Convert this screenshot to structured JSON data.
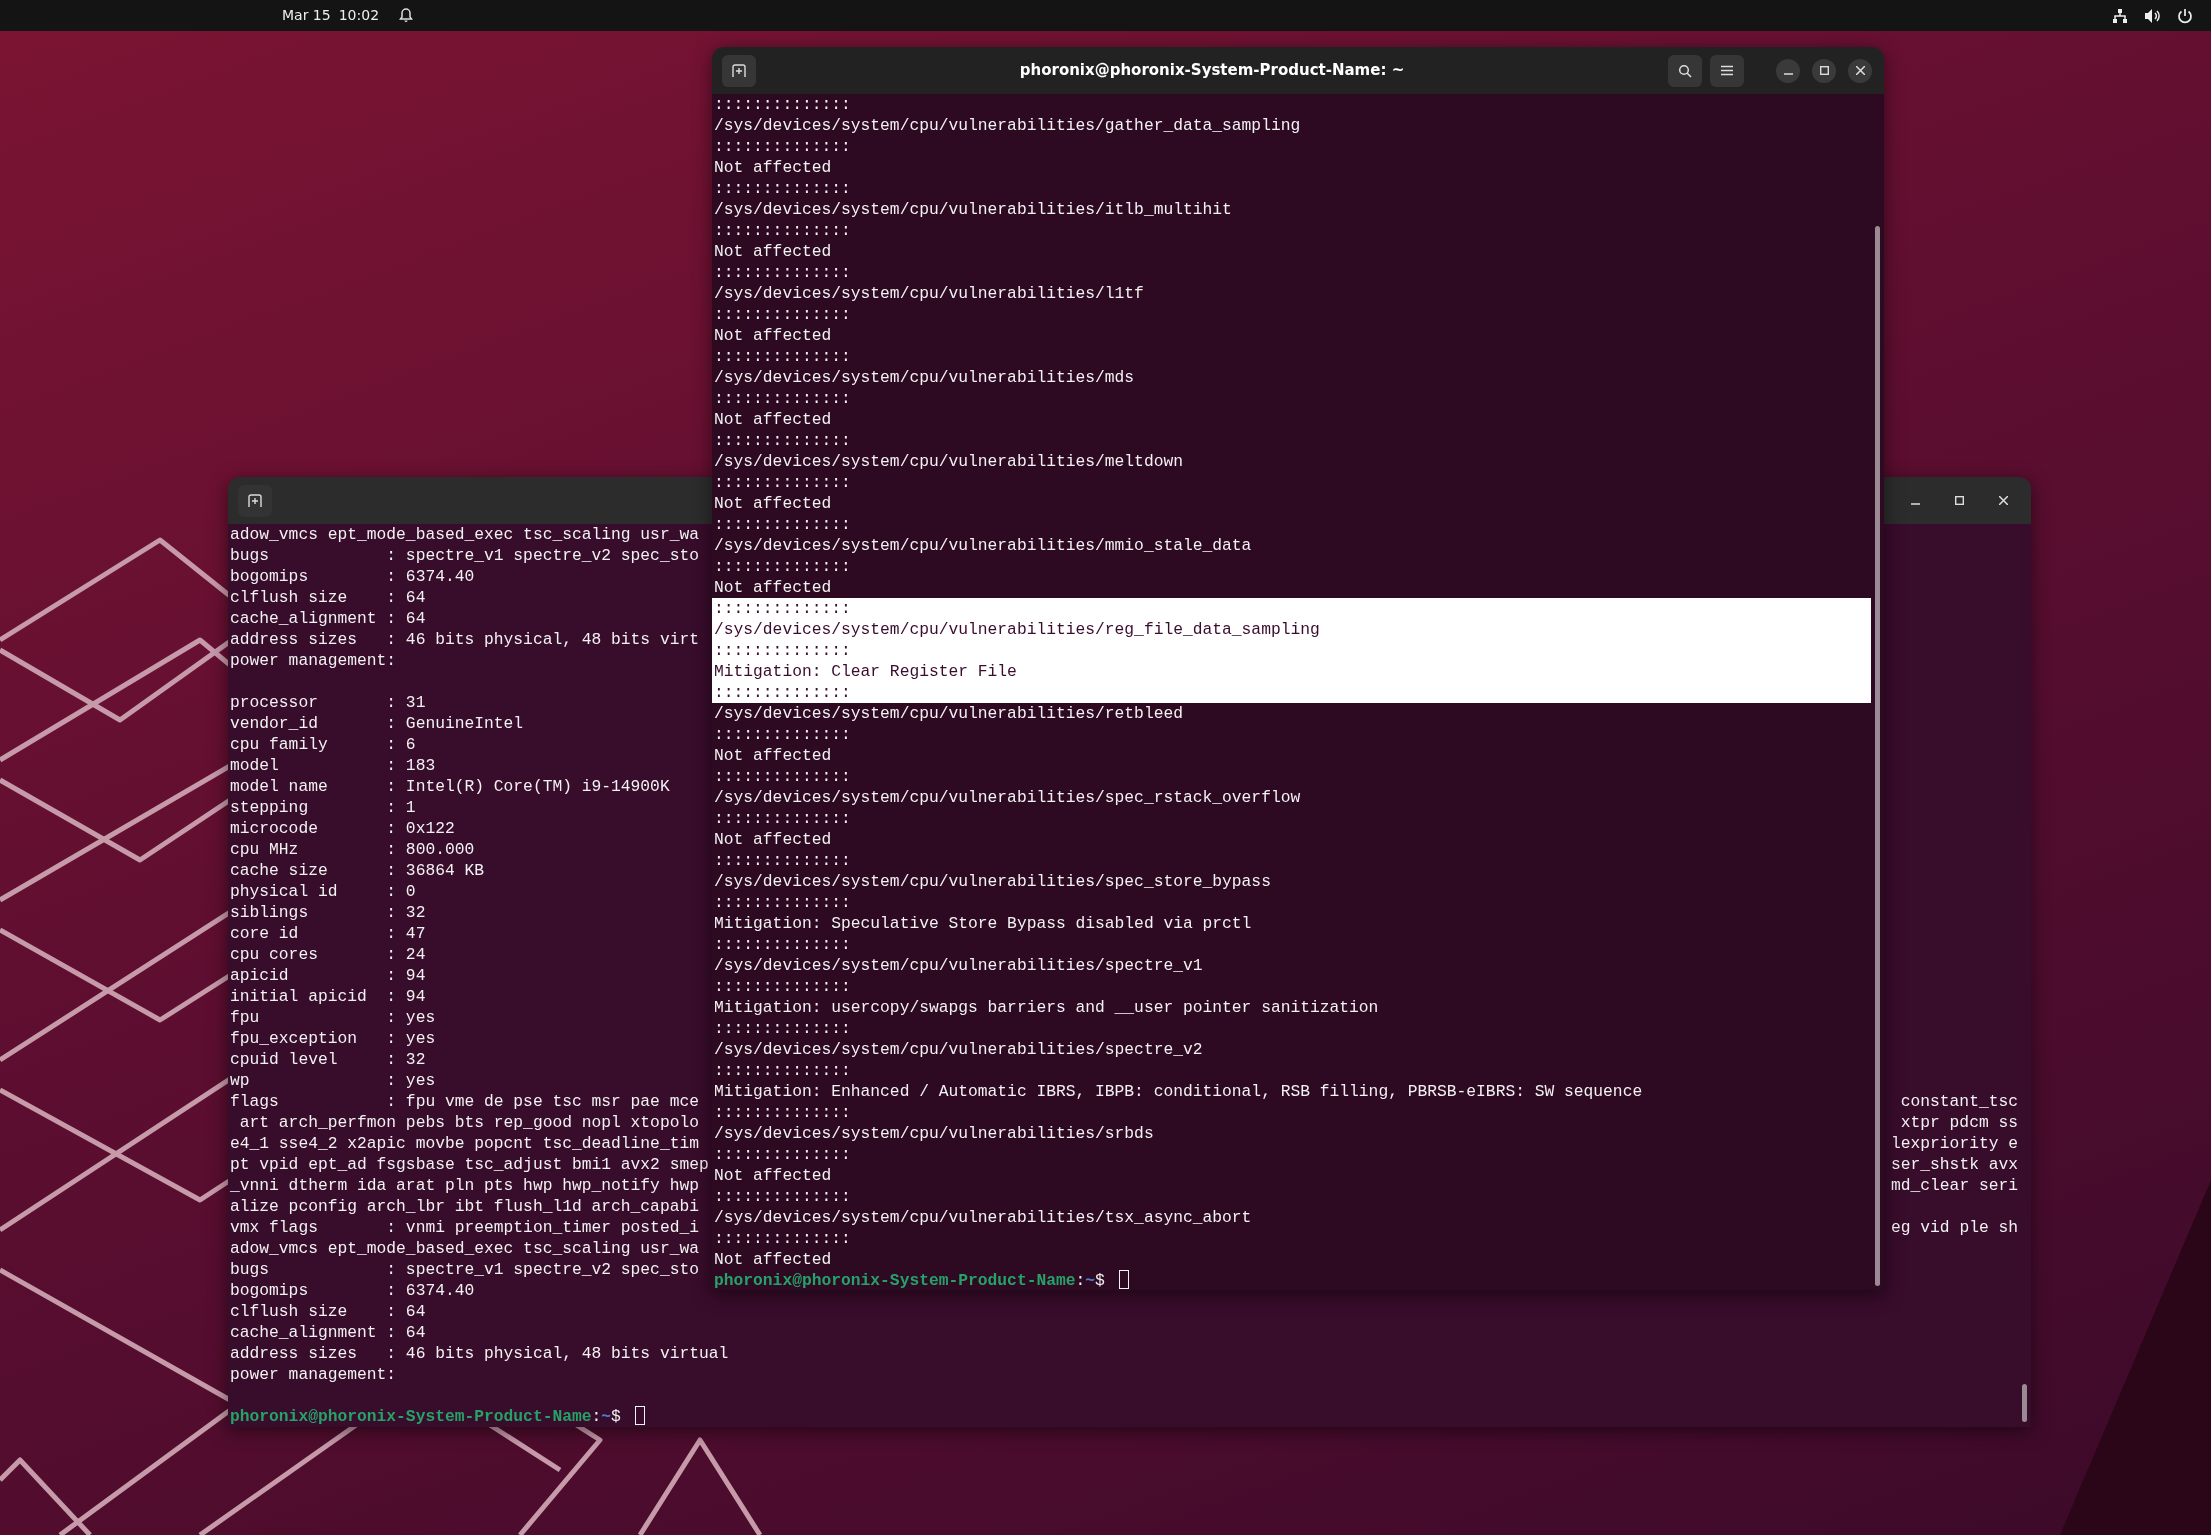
{
  "top_bar": {
    "date": "Mar 15",
    "time": "10:02"
  },
  "windows": [
    {
      "focused": false,
      "lines": [
        {
          "text": "adow_vmcs ept_mode_based_exec tsc_scaling usr_wa"
        },
        {
          "text": "bugs            : spectre_v1 spectre_v2 spec_sto"
        },
        {
          "text": "bogomips        : 6374.40"
        },
        {
          "text": "clflush size    : 64"
        },
        {
          "text": "cache_alignment : 64"
        },
        {
          "text": "address sizes   : 46 bits physical, 48 bits virt"
        },
        {
          "text": "power management:"
        },
        {
          "text": "processor       : 31",
          "gap_before": true
        },
        {
          "text": "vendor_id       : GenuineIntel"
        },
        {
          "text": "cpu family      : 6"
        },
        {
          "text": "model           : 183"
        },
        {
          "text": "model name      : Intel(R) Core(TM) i9-14900K"
        },
        {
          "text": "stepping        : 1"
        },
        {
          "text": "microcode       : 0x122"
        },
        {
          "text": "cpu MHz         : 800.000"
        },
        {
          "text": "cache size      : 36864 KB"
        },
        {
          "text": "physical id     : 0"
        },
        {
          "text": "siblings        : 32"
        },
        {
          "text": "core id         : 47"
        },
        {
          "text": "cpu cores       : 24"
        },
        {
          "text": "apicid          : 94"
        },
        {
          "text": "initial apicid  : 94"
        },
        {
          "text": "fpu             : yes"
        },
        {
          "text": "fpu_exception   : yes"
        },
        {
          "text": "cpuid level     : 32"
        },
        {
          "text": "wp              : yes"
        },
        {
          "text": "flags           : fpu vme de pse tsc msr pae mce",
          "right": "constant_tsc"
        },
        {
          "text": " art arch_perfmon pebs bts rep_good nopl xtopolo",
          "right": "xtpr pdcm ss"
        },
        {
          "text": "e4_1 sse4_2 x2apic movbe popcnt tsc_deadline_tim",
          "right": "lexpriority e"
        },
        {
          "text": "pt vpid ept_ad fsgsbase tsc_adjust bmi1 avx2 smep",
          "right": "ser_shstk avx"
        },
        {
          "text": "_vnni dtherm ida arat pln pts hwp hwp_notify hwp",
          "right": "md_clear seri"
        },
        {
          "text": "alize pconfig arch_lbr ibt flush_l1d arch_capabi"
        },
        {
          "text": "vmx flags       : vnmi preemption_timer posted_i",
          "right": "eg vid ple sh"
        },
        {
          "text": "adow_vmcs ept_mode_based_exec tsc_scaling usr_wa"
        },
        {
          "text": "bugs            : spectre_v1 spectre_v2 spec_sto"
        },
        {
          "text": "bogomips        : 6374.40"
        },
        {
          "text": "clflush size    : 64"
        },
        {
          "text": "cache_alignment : 64"
        },
        {
          "text": "address sizes   : 46 bits physical, 48 bits virtual"
        },
        {
          "text": "power management:"
        }
      ],
      "prompt": {
        "user_host": "phoronix@phoronix-System-Product-Name",
        "separator": ":",
        "path": "~",
        "symbol": "$",
        "gap_before": true
      }
    },
    {
      "focused": true,
      "title": "phoronix@phoronix-System-Product-Name: ~",
      "lines": [
        {
          "text": "::::::::::::::",
          "selected": false
        },
        {
          "text": "/sys/devices/system/cpu/vulnerabilities/gather_data_sampling",
          "selected": false
        },
        {
          "text": "::::::::::::::",
          "selected": false
        },
        {
          "text": "Not affected",
          "selected": false
        },
        {
          "text": "::::::::::::::",
          "selected": false
        },
        {
          "text": "/sys/devices/system/cpu/vulnerabilities/itlb_multihit",
          "selected": false
        },
        {
          "text": "::::::::::::::",
          "selected": false
        },
        {
          "text": "Not affected",
          "selected": false
        },
        {
          "text": "::::::::::::::",
          "selected": false
        },
        {
          "text": "/sys/devices/system/cpu/vulnerabilities/l1tf",
          "selected": false
        },
        {
          "text": "::::::::::::::",
          "selected": false
        },
        {
          "text": "Not affected",
          "selected": false
        },
        {
          "text": "::::::::::::::",
          "selected": false
        },
        {
          "text": "/sys/devices/system/cpu/vulnerabilities/mds",
          "selected": false
        },
        {
          "text": "::::::::::::::",
          "selected": false
        },
        {
          "text": "Not affected",
          "selected": false
        },
        {
          "text": "::::::::::::::",
          "selected": false
        },
        {
          "text": "/sys/devices/system/cpu/vulnerabilities/meltdown",
          "selected": false
        },
        {
          "text": "::::::::::::::",
          "selected": false
        },
        {
          "text": "Not affected",
          "selected": false
        },
        {
          "text": "::::::::::::::",
          "selected": false
        },
        {
          "text": "/sys/devices/system/cpu/vulnerabilities/mmio_stale_data",
          "selected": false
        },
        {
          "text": "::::::::::::::",
          "selected": false
        },
        {
          "text": "Not affected",
          "selected": false
        },
        {
          "text": "::::::::::::::",
          "selected": true
        },
        {
          "text": "/sys/devices/system/cpu/vulnerabilities/reg_file_data_sampling",
          "selected": true
        },
        {
          "text": "::::::::::::::",
          "selected": true
        },
        {
          "text": "Mitigation: Clear Register File",
          "selected": true
        },
        {
          "text": "::::::::::::::",
          "selected": true
        },
        {
          "text": "/sys/devices/system/cpu/vulnerabilities/retbleed",
          "selected": false
        },
        {
          "text": "::::::::::::::",
          "selected": false
        },
        {
          "text": "Not affected",
          "selected": false
        },
        {
          "text": "::::::::::::::",
          "selected": false
        },
        {
          "text": "/sys/devices/system/cpu/vulnerabilities/spec_rstack_overflow",
          "selected": false
        },
        {
          "text": "::::::::::::::",
          "selected": false
        },
        {
          "text": "Not affected",
          "selected": false
        },
        {
          "text": "::::::::::::::",
          "selected": false
        },
        {
          "text": "/sys/devices/system/cpu/vulnerabilities/spec_store_bypass",
          "selected": false
        },
        {
          "text": "::::::::::::::",
          "selected": false
        },
        {
          "text": "Mitigation: Speculative Store Bypass disabled via prctl",
          "selected": false
        },
        {
          "text": "::::::::::::::",
          "selected": false
        },
        {
          "text": "/sys/devices/system/cpu/vulnerabilities/spectre_v1",
          "selected": false
        },
        {
          "text": "::::::::::::::",
          "selected": false
        },
        {
          "text": "Mitigation: usercopy/swapgs barriers and __user pointer sanitization",
          "selected": false
        },
        {
          "text": "::::::::::::::",
          "selected": false
        },
        {
          "text": "/sys/devices/system/cpu/vulnerabilities/spectre_v2",
          "selected": false
        },
        {
          "text": "::::::::::::::",
          "selected": false
        },
        {
          "text": "Mitigation: Enhanced / Automatic IBRS, IBPB: conditional, RSB filling, PBRSB-eIBRS: SW sequence",
          "selected": false
        },
        {
          "text": "::::::::::::::",
          "selected": false
        },
        {
          "text": "/sys/devices/system/cpu/vulnerabilities/srbds",
          "selected": false
        },
        {
          "text": "::::::::::::::",
          "selected": false
        },
        {
          "text": "Not affected",
          "selected": false
        },
        {
          "text": "::::::::::::::",
          "selected": false
        },
        {
          "text": "/sys/devices/system/cpu/vulnerabilities/tsx_async_abort",
          "selected": false
        },
        {
          "text": "::::::::::::::",
          "selected": false
        },
        {
          "text": "Not affected",
          "selected": false
        }
      ],
      "prompt": {
        "user_host": "phoronix@phoronix-System-Product-Name",
        "separator": ":",
        "path": "~",
        "symbol": "$"
      }
    }
  ]
}
